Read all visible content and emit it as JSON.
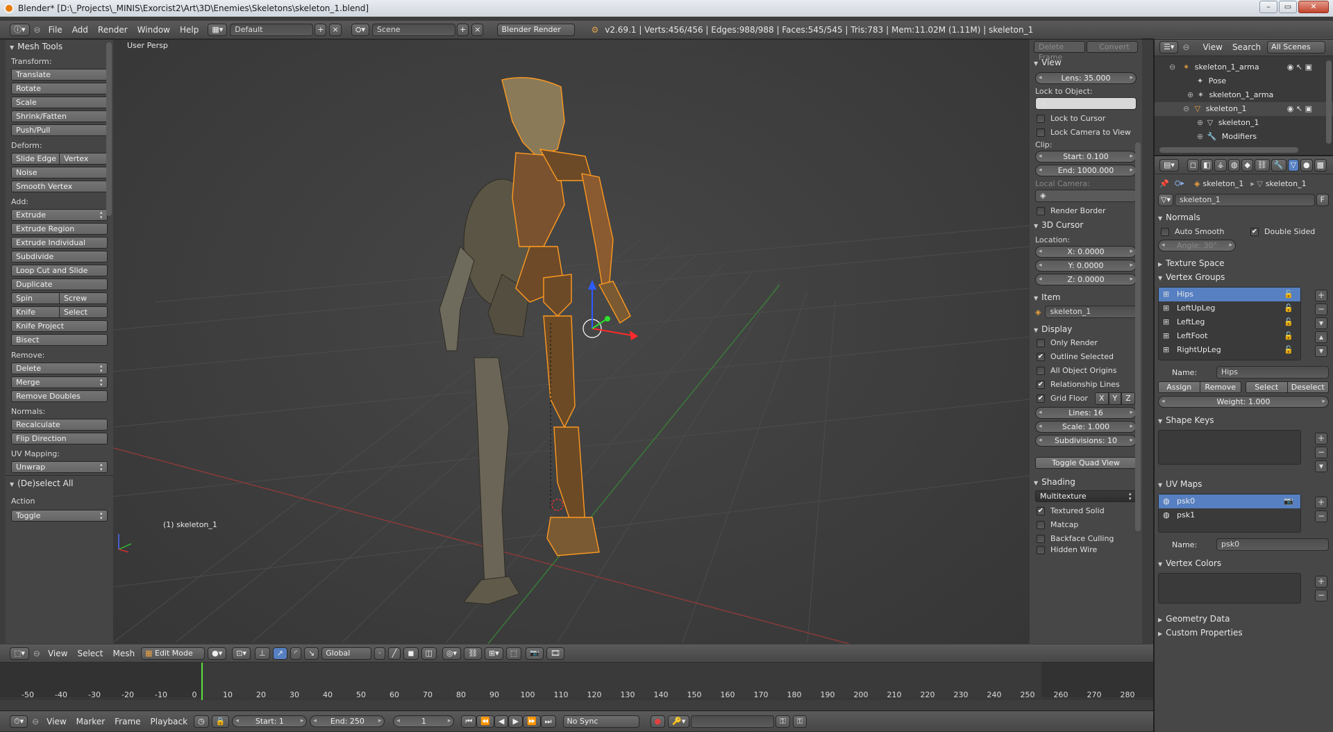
{
  "window": {
    "title": "Blender* [D:\\_Projects\\_MINIS\\Exorcist2\\Art\\3D\\Enemies\\Skeletons\\skeleton_1.blend]",
    "controls": [
      "–",
      "▭",
      "✕"
    ]
  },
  "info_header": {
    "menus": [
      "File",
      "Add",
      "Render",
      "Window",
      "Help"
    ],
    "layout": "Default",
    "scene": "Scene",
    "engine": "Blender Render",
    "stats": "v2.69.1 | Verts:456/456 | Edges:988/988 | Faces:545/545 | Tris:783 | Mem:11.02M (1.11M) | skeleton_1"
  },
  "toolshelf": {
    "title": "Mesh Tools",
    "transform_label": "Transform:",
    "transform": [
      "Translate",
      "Rotate",
      "Scale",
      "Shrink/Fatten",
      "Push/Pull"
    ],
    "deform_label": "Deform:",
    "slide_edge": "Slide Edge",
    "vertex": "Vertex",
    "noise": "Noise",
    "smooth_vertex": "Smooth Vertex",
    "add_label": "Add:",
    "extrude": "Extrude",
    "add_items": [
      "Extrude Region",
      "Extrude Individual",
      "Subdivide",
      "Loop Cut and Slide",
      "Duplicate"
    ],
    "spin": "Spin",
    "screw": "Screw",
    "knife": "Knife",
    "select": "Select",
    "knife_project": "Knife Project",
    "bisect": "Bisect",
    "remove_label": "Remove:",
    "delete": "Delete",
    "merge": "Merge",
    "remove_doubles": "Remove Doubles",
    "normals_label": "Normals:",
    "recalculate": "Recalculate",
    "flip_direction": "Flip Direction",
    "uv_label": "UV Mapping:",
    "unwrap": "Unwrap",
    "deselect_title": "(De)select All",
    "action_label": "Action",
    "action_value": "Toggle"
  },
  "viewport": {
    "persp_label": "User Persp",
    "object_label": "(1) skeleton_1"
  },
  "npanel": {
    "top_buttons": [
      "Delete Frame",
      "Convert"
    ],
    "view_title": "View",
    "lens": "Lens: 35.000",
    "lock_to_object": "Lock to Object:",
    "lock_to_cursor": "Lock to Cursor",
    "lock_camera": "Lock Camera to View",
    "clip_label": "Clip:",
    "clip_start": "Start: 0.100",
    "clip_end": "End: 1000.000",
    "local_camera": "Local Camera:",
    "render_border": "Render Border",
    "cursor_title": "3D Cursor",
    "location_label": "Location:",
    "cx": "X: 0.0000",
    "cy": "Y: 0.0000",
    "cz": "Z: 0.0000",
    "item_title": "Item",
    "item_name": "skeleton_1",
    "display_title": "Display",
    "only_render": "Only Render",
    "outline_selected": "Outline Selected",
    "all_origins": "All Object Origins",
    "relationship_lines": "Relationship Lines",
    "grid_floor": "Grid Floor",
    "axis_x": "X",
    "axis_y": "Y",
    "axis_z": "Z",
    "lines": "Lines: 16",
    "scale": "Scale: 1.000",
    "subdivisions": "Subdivisions: 10",
    "toggle_quad": "Toggle Quad View",
    "shading_title": "Shading",
    "shading_mode": "Multitexture",
    "textured_solid": "Textured Solid",
    "matcap": "Matcap",
    "backface_culling": "Backface Culling",
    "hidden_wire": "Hidden Wire"
  },
  "outliner": {
    "view": "View",
    "search": "Search",
    "all_scenes": "All Scenes",
    "rows": [
      "skeleton_1_arma",
      "Pose",
      "skeleton_1_arma",
      "skeleton_1",
      "skeleton_1",
      "Modifiers"
    ]
  },
  "properties": {
    "breadcrumb_a": "skeleton_1",
    "breadcrumb_b": "skeleton_1",
    "mesh_name": "skeleton_1",
    "fake_user": "F",
    "normals_title": "Normals",
    "auto_smooth": "Auto Smooth",
    "double_sided": "Double Sided",
    "angle": "Angle: 30°",
    "texture_space": "Texture Space",
    "vertex_groups_title": "Vertex Groups",
    "vertex_groups": [
      "Hips",
      "LeftUpLeg",
      "LeftLeg",
      "LeftFoot",
      "RightUpLeg"
    ],
    "name_label": "Name:",
    "vg_name": "Hips",
    "assign": "Assign",
    "remove": "Remove",
    "select": "Select",
    "deselect": "Deselect",
    "weight": "Weight: 1.000",
    "shape_keys_title": "Shape Keys",
    "uv_maps_title": "UV Maps",
    "uv_maps": [
      "psk0",
      "psk1"
    ],
    "uv_name": "psk0",
    "vertex_colors_title": "Vertex Colors",
    "geometry_data": "Geometry Data",
    "custom_properties": "Custom Properties"
  },
  "view3d_header": {
    "menus": [
      "View",
      "Select",
      "Mesh"
    ],
    "mode": "Edit Mode",
    "orientation": "Global"
  },
  "timeline": {
    "ticks": [
      "-50",
      "-40",
      "-30",
      "-20",
      "-10",
      "0",
      "10",
      "20",
      "30",
      "40",
      "50",
      "60",
      "70",
      "80",
      "90",
      "100",
      "110",
      "120",
      "130",
      "140",
      "150",
      "160",
      "170",
      "180",
      "190",
      "200",
      "210",
      "220",
      "230",
      "240",
      "250",
      "260",
      "270",
      "280"
    ],
    "menus": [
      "View",
      "Marker",
      "Frame",
      "Playback"
    ],
    "start": "Start: 1",
    "end": "End: 250",
    "current": "1",
    "sync": "No Sync"
  },
  "colors": {
    "selected_wire": "#ff9a1f",
    "highlight": "#5680c2",
    "current_frame": "#5be03c"
  }
}
